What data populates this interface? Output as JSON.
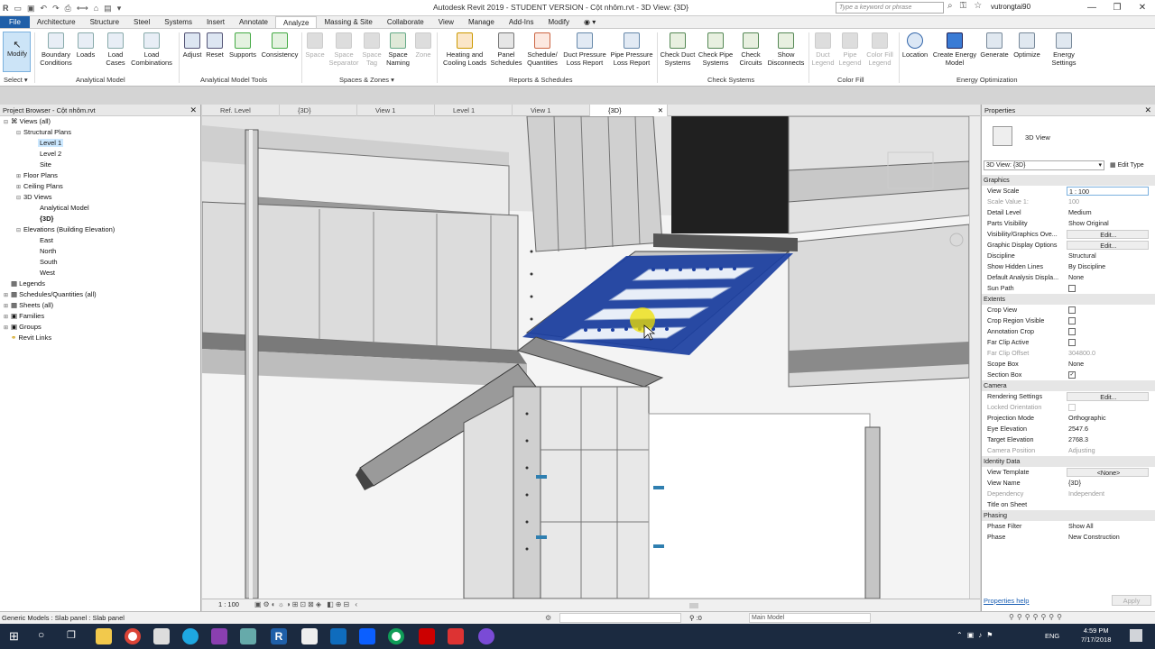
{
  "titlebar": {
    "title": "Autodesk Revit 2019 - STUDENT VERSION - Cột nhôm.rvt - 3D View: {3D}",
    "search_placeholder": "Type a keyword or phrase",
    "user": "vutrongtai90"
  },
  "tabs": [
    "File",
    "Architecture",
    "Structure",
    "Steel",
    "Systems",
    "Insert",
    "Annotate",
    "Analyze",
    "Massing & Site",
    "Collaborate",
    "View",
    "Manage",
    "Add-Ins",
    "Modify"
  ],
  "ribbon": {
    "modify": "Modify",
    "select": "Select ▾",
    "analytical_model": {
      "label": "Analytical Model",
      "buttons": [
        "Boundary Conditions",
        "Loads",
        "Load Cases",
        "Load Combinations"
      ]
    },
    "analytical_tools": {
      "label": "Analytical Model Tools",
      "buttons": [
        "Adjust",
        "Reset",
        "Supports",
        "Consistency"
      ]
    },
    "spaces": {
      "label": "Spaces & Zones",
      "buttons": [
        "Space",
        "Space Separator",
        "Space Tag",
        "Space Naming",
        "Zone"
      ]
    },
    "reports": {
      "label": "Reports & Schedules",
      "buttons": [
        "Heating and Cooling Loads",
        "Panel Schedules",
        "Schedule/ Quantities",
        "Duct Pressure Loss Report",
        "Pipe Pressure Loss Report"
      ]
    },
    "check": {
      "label": "Check Systems",
      "buttons": [
        "Check Duct Systems",
        "Check Pipe Systems",
        "Check Circuits",
        "Show Disconnects"
      ]
    },
    "colorfill": {
      "label": "Color Fill",
      "buttons": [
        "Duct Legend",
        "Pipe Legend",
        "Color Fill Legend"
      ]
    },
    "energy": {
      "label": "Energy Optimization",
      "buttons": [
        "Location",
        "Create Energy Model",
        "Generate",
        "Optimize",
        "Energy Settings"
      ]
    }
  },
  "doctabs": [
    "Ref. Level",
    "{3D}",
    "View 1",
    "Level 1",
    "View 1",
    "{3D}"
  ],
  "project_browser": {
    "title": "Project Browser - Cột nhôm.rvt",
    "items": [
      "Views (all)",
      "Structural Plans",
      "Level 1",
      "Level 2",
      "Site",
      "Floor Plans",
      "Ceiling Plans",
      "3D Views",
      "Analytical Model",
      "{3D}",
      "Elevations (Building Elevation)",
      "East",
      "North",
      "South",
      "West",
      "Legends",
      "Schedules/Quantities (all)",
      "Sheets (all)",
      "Families",
      "Groups",
      "Revit Links"
    ]
  },
  "view": {
    "scale": "1 : 100"
  },
  "properties": {
    "title": "Properties",
    "type": "3D View",
    "selector": "3D View: {3D}",
    "edit_type": "Edit Type",
    "help": "Properties help",
    "apply": "Apply",
    "groups": {
      "graphics": "Graphics",
      "extents": "Extents",
      "camera": "Camera",
      "identity": "Identity Data",
      "phasing": "Phasing"
    },
    "rows": {
      "view_scale": [
        "View Scale",
        "1 : 100"
      ],
      "scale_value": [
        "Scale Value    1:",
        "100"
      ],
      "detail_level": [
        "Detail Level",
        "Medium"
      ],
      "parts_visibility": [
        "Parts Visibility",
        "Show Original"
      ],
      "vg": [
        "Visibility/Graphics Ove...",
        "Edit..."
      ],
      "gdo": [
        "Graphic Display Options",
        "Edit..."
      ],
      "discipline": [
        "Discipline",
        "Structural"
      ],
      "hidden_lines": [
        "Show Hidden Lines",
        "By Discipline"
      ],
      "analysis": [
        "Default Analysis Displa...",
        "None"
      ],
      "sun_path": [
        "Sun Path",
        ""
      ],
      "crop_view": [
        "Crop View",
        ""
      ],
      "crop_region": [
        "Crop Region Visible",
        ""
      ],
      "annotation_crop": [
        "Annotation Crop",
        ""
      ],
      "far_clip": [
        "Far Clip Active",
        ""
      ],
      "far_offset": [
        "Far Clip Offset",
        "304800.0"
      ],
      "scope_box": [
        "Scope Box",
        "None"
      ],
      "section_box": [
        "Section Box",
        ""
      ],
      "rendering": [
        "Rendering Settings",
        "Edit..."
      ],
      "locked": [
        "Locked Orientation",
        ""
      ],
      "projection": [
        "Projection Mode",
        "Orthographic"
      ],
      "eye": [
        "Eye Elevation",
        "2547.6"
      ],
      "target": [
        "Target Elevation",
        "2768.3"
      ],
      "camera_pos": [
        "Camera Position",
        "Adjusting"
      ],
      "template": [
        "View Template",
        "<None>"
      ],
      "view_name": [
        "View Name",
        "{3D}"
      ],
      "dependency": [
        "Dependency",
        "Independent"
      ],
      "title_sheet": [
        "Title on Sheet",
        ""
      ],
      "phase_filter": [
        "Phase Filter",
        "Show All"
      ],
      "phase": [
        "Phase",
        "New Construction"
      ]
    }
  },
  "status": {
    "text": "Generic Models : Slab panel : Slab panel",
    "zero": ":0",
    "model": "Main Model"
  },
  "taskbar": {
    "lang": "ENG",
    "time": "4:59 PM",
    "date": "7/17/2018"
  },
  "colors": {
    "accent": "#1f5fa8",
    "selection": "#1c3fa0"
  }
}
